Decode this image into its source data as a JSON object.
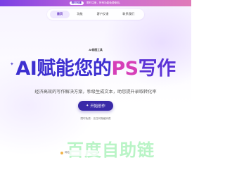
{
  "announcement": {
    "badge": "限时优惠",
    "message": "限时注册，所有功能免费使用。"
  },
  "nav": {
    "items": [
      {
        "label": "首页",
        "active": true
      },
      {
        "label": "功能",
        "active": false
      },
      {
        "label": "客户反馈",
        "active": false
      },
      {
        "label": "联系我们",
        "active": false
      }
    ]
  },
  "hero": {
    "tagline": "AI修图工具",
    "headline_a": "AI赋能您的",
    "headline_b": "PS",
    "headline_c": "写作",
    "subtitle": "经济高效的写作解决方案，秒级生成文本，助您提升录取转化率",
    "cta_label": "开始创作",
    "note": "限时免费 · 无任何隐藏消费"
  },
  "watermark": {
    "text": "百度自助链",
    "chip_label": "网站"
  },
  "colors": {
    "brand": "#3a2aa8",
    "accent_pink": "#d63fb8",
    "announce_start": "#7b3fe4",
    "announce_end": "#e07ab8"
  }
}
